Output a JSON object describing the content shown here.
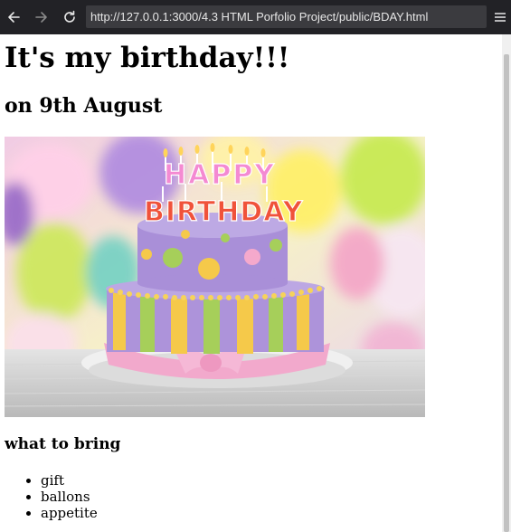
{
  "browser": {
    "url": "http://127.0.0.1:3000/4.3 HTML Porfolio Project/public/BDAY.html",
    "icons": {
      "back": "back-arrow-icon",
      "forward": "forward-arrow-icon",
      "reload": "reload-icon",
      "menu": "hamburger-menu-icon"
    }
  },
  "page": {
    "heading": "It's my birthday!!!",
    "subheading": "on 9th August",
    "image": {
      "sign_line1": "HAPPY",
      "sign_line2": "BIRTHDAY"
    },
    "list_heading": "what to bring",
    "items": [
      "gift",
      "ballons",
      "appetite"
    ]
  },
  "colors": {
    "toolbar": "#222226",
    "url_bar": "#3b3b3f",
    "cake_purple": "#a98fd8",
    "cake_yellow": "#f5c94a",
    "cake_green": "#a6cf5a",
    "ribbon_pink": "#f2a9cc"
  }
}
